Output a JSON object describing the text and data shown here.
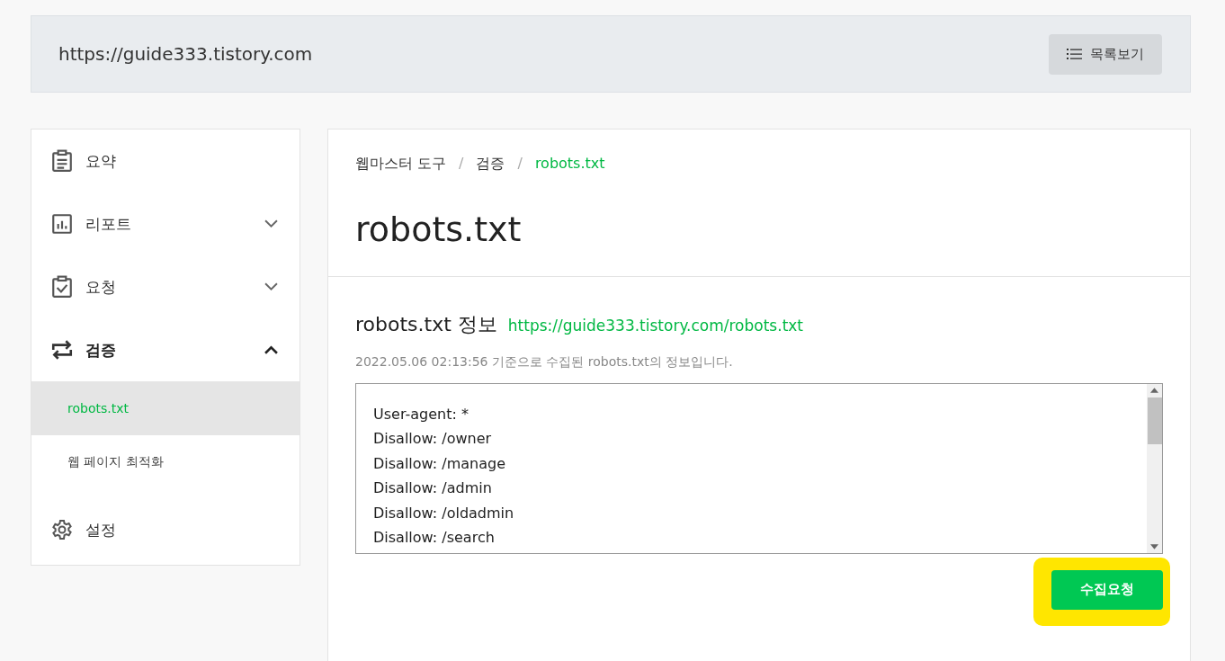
{
  "header": {
    "site_url": "https://guide333.tistory.com",
    "list_button": "목록보기"
  },
  "sidebar": {
    "items": [
      {
        "label": "요약",
        "active": false
      },
      {
        "label": "리포트",
        "active": false,
        "expanded": false
      },
      {
        "label": "요청",
        "active": false,
        "expanded": false
      },
      {
        "label": "검증",
        "active": true,
        "expanded": true,
        "children": [
          {
            "label": "robots.txt",
            "selected": true
          },
          {
            "label": "웹 페이지 최적화",
            "selected": false
          }
        ]
      },
      {
        "label": "설정",
        "active": false
      }
    ]
  },
  "breadcrumb": [
    {
      "label": "웹마스터 도구",
      "current": false
    },
    {
      "label": "검증",
      "current": false
    },
    {
      "label": "robots.txt",
      "current": true
    }
  ],
  "breadcrumb_separator": "/",
  "page_title": "robots.txt",
  "section": {
    "title": "robots.txt 정보",
    "link": "https://guide333.tistory.com/robots.txt",
    "note": "2022.05.06 02:13:56 기준으로 수집된 robots.txt의 정보입니다.",
    "content_lines": [
      "User-agent: *",
      "Disallow: /owner",
      "Disallow: /manage",
      "Disallow: /admin",
      "Disallow: /oldadmin",
      "Disallow: /search"
    ],
    "button": "수집요청",
    "button_highlighted": true
  }
}
